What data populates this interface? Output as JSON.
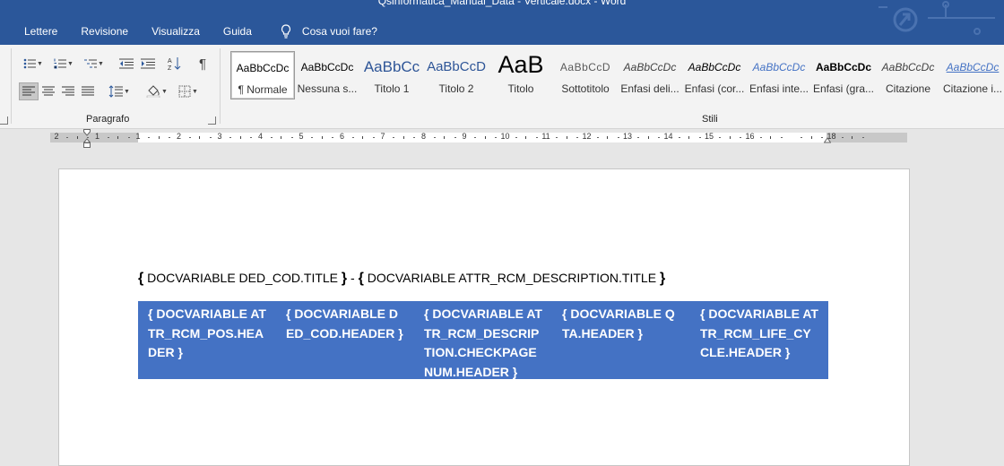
{
  "window": {
    "title": "Qsinformatica_Manual_Data - Verticale.docx  -  Word"
  },
  "tabs": [
    "Lettere",
    "Revisione",
    "Visualizza",
    "Guida"
  ],
  "tell_me": {
    "label": "Cosa vuoi fare?",
    "icon": "lightbulb-icon"
  },
  "ribbon": {
    "groups": {
      "paragraph": "Paragrafo",
      "styles": "Stili"
    },
    "styles": [
      {
        "sample": "AaBbCcDc",
        "name": "¶ Normale"
      },
      {
        "sample": "AaBbCcDc",
        "name": "Nessuna s..."
      },
      {
        "sample": "AaBbCc",
        "name": "Titolo 1"
      },
      {
        "sample": "AaBbCcD",
        "name": "Titolo 2"
      },
      {
        "sample": "AaB",
        "name": "Titolo"
      },
      {
        "sample": "AaBbCcD",
        "name": "Sottotitolo"
      },
      {
        "sample": "AaBbCcDc",
        "name": "Enfasi deli..."
      },
      {
        "sample": "AaBbCcDc",
        "name": "Enfasi (cor..."
      },
      {
        "sample": "AaBbCcDc",
        "name": "Enfasi inte..."
      },
      {
        "sample": "AaBbCcDc",
        "name": "Enfasi (gra..."
      },
      {
        "sample": "AaBbCcDc",
        "name": "Citazione"
      },
      {
        "sample": "AaBbCcDc",
        "name": "Citazione i..."
      }
    ]
  },
  "ruler": {
    "numbers": [
      "2",
      "1",
      "1",
      "2",
      "3",
      "4",
      "5",
      "6",
      "7",
      "8",
      "9",
      "10",
      "11",
      "12",
      "13",
      "14",
      "15",
      "16",
      "18"
    ]
  },
  "document": {
    "line": {
      "open1": "{",
      "field1": " DOCVARIABLE  DED_COD.TITLE ",
      "close1": "}",
      "separator": " - ",
      "open2": "{",
      "field2": " DOCVARIABLE  ATTR_RCM_DESCRIPTION.TITLE ",
      "close2": "}"
    },
    "table_header": [
      "{ DOCVARIABLE ATTR_RCM_POS.HEADER }",
      "{ DOCVARIABLE DED_COD.HEADER }",
      "{ DOCVARIABLE ATTR_RCM_DESCRIPTION.CHECKPAGENUM.HEADER }",
      "{ DOCVARIABLE QTA.HEADER }",
      "{ DOCVARIABLE ATTR_RCM_LIFE_CYCLE.HEADER }"
    ],
    "colors": {
      "table_header_bg": "#4472c4",
      "ribbon_accent": "#2b579a"
    }
  }
}
